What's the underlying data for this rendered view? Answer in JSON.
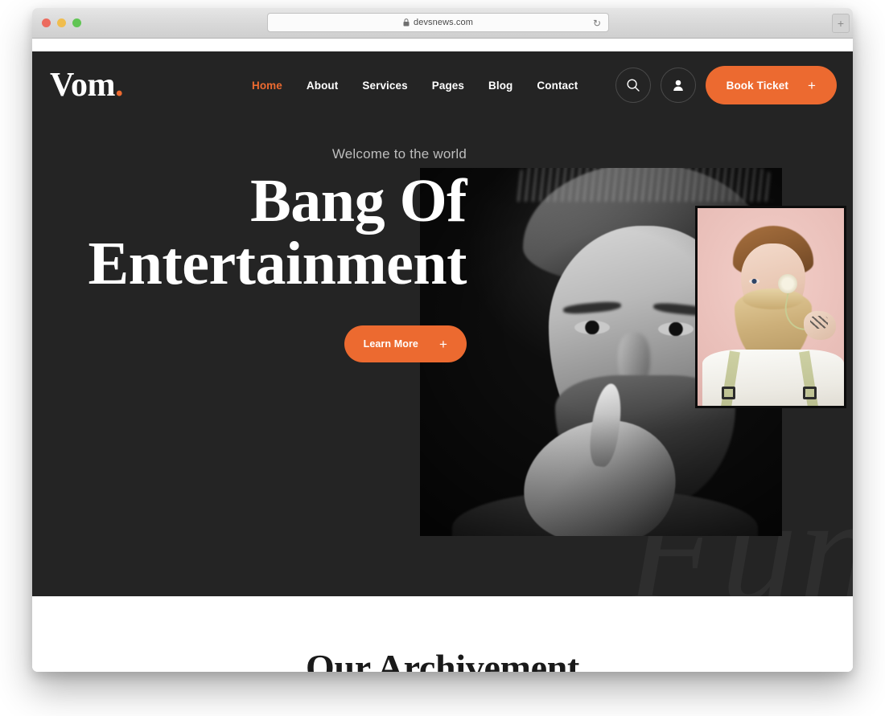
{
  "browser": {
    "url": "devsnews.com",
    "lock_icon": "lock-icon",
    "reload_icon": "reload-icon",
    "new_tab_label": "+",
    "traffic_lights": [
      "close",
      "minimize",
      "maximize"
    ]
  },
  "site": {
    "header": {
      "logo_text": "Vom",
      "logo_dot": ".",
      "nav": [
        {
          "label": "Home",
          "active": true
        },
        {
          "label": "About",
          "active": false
        },
        {
          "label": "Services",
          "active": false
        },
        {
          "label": "Pages",
          "active": false
        },
        {
          "label": "Blog",
          "active": false
        },
        {
          "label": "Contact",
          "active": false
        }
      ],
      "search_icon": "search-icon",
      "account_icon": "user-icon",
      "book_ticket_label": "Book Ticket",
      "book_ticket_plus": "+"
    },
    "hero": {
      "eyebrow": "Welcome to the world",
      "title_line1": "Bang Of",
      "title_line2": "Entertainment",
      "cta_label": "Learn More",
      "cta_plus": "+",
      "watermark": "Fun",
      "photo_main_alt": "black-and-white portrait of bearded man with hand on chin",
      "photo_inset_alt": "bearded man holding a dandelion over his eye on pink background"
    },
    "achievement": {
      "title": "Our Archivement"
    }
  },
  "colors": {
    "accent": "#ec6a30",
    "hero_bg": "#242424",
    "watermark": "#2e2e2e",
    "nav_text": "#ffffff",
    "eyebrow_text": "#bdbdbd"
  }
}
